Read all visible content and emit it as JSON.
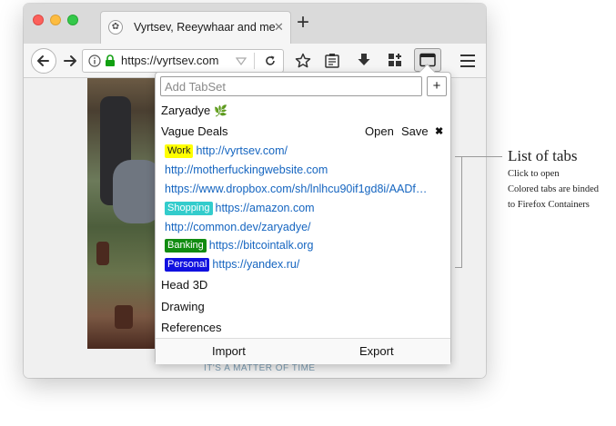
{
  "browser": {
    "tab_title": "Vyrtsev, Reeywhaar and me",
    "tab_close": "✕",
    "new_tab": "+",
    "url": "https://vyrtsev.com"
  },
  "page": {
    "tagline": "IT'S A MATTER OF TIME"
  },
  "popup": {
    "add_placeholder": "Add TabSet",
    "add_button": "+",
    "tabsets": [
      {
        "name": "Zaryadye",
        "icon": "leaf-icon"
      },
      {
        "name": "Vague Deals"
      },
      {
        "name": "Head 3D"
      },
      {
        "name": "Drawing"
      },
      {
        "name": "References"
      }
    ],
    "open_label": "Open",
    "save_label": "Save",
    "delete_label": "✖",
    "links": [
      {
        "badge": "Work",
        "badge_bg": "#ffff00",
        "badge_fg": "#222222",
        "url": "http://vyrtsev.com/"
      },
      {
        "badge": "",
        "url": "http://motherfuckingwebsite.com"
      },
      {
        "badge": "",
        "url": "https://www.dropbox.com/sh/lnlhcu90if1gd8i/AADf…"
      },
      {
        "badge": "Shopping",
        "badge_bg": "#33cccc",
        "badge_fg": "#ffffff",
        "url": "https://amazon.com"
      },
      {
        "badge": "",
        "url": "http://common.dev/zaryadye/"
      },
      {
        "badge": "Banking",
        "badge_bg": "#118c11",
        "badge_fg": "#ffffff",
        "url": "https://bitcointalk.org"
      },
      {
        "badge": "Personal",
        "badge_bg": "#1010e0",
        "badge_fg": "#ffffff",
        "url": "https://yandex.ru/"
      }
    ],
    "import_label": "Import",
    "export_label": "Export"
  },
  "annotation": {
    "title": "List of tabs",
    "lines": [
      "Click to open",
      "Colored tabs are binded",
      "to Firefox Containers"
    ]
  }
}
